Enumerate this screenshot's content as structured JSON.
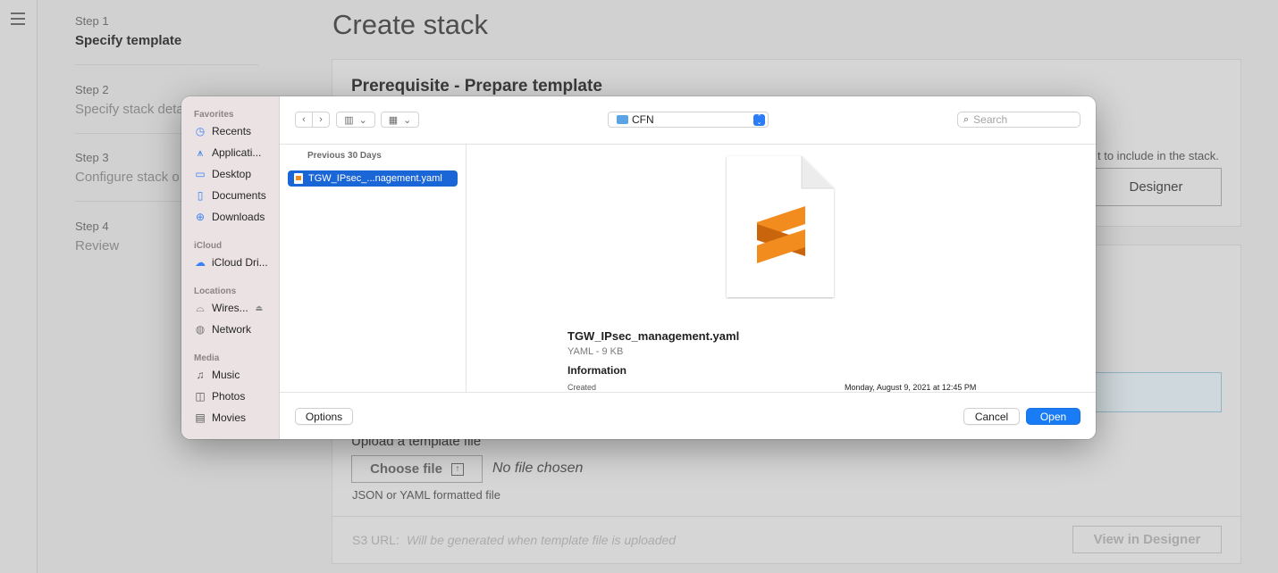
{
  "background": {
    "page_title": "Create stack",
    "steps": [
      {
        "num": "Step 1",
        "label": "Specify template"
      },
      {
        "num": "Step 2",
        "label": "Specify stack deta"
      },
      {
        "num": "Step 3",
        "label": "Configure stack o"
      },
      {
        "num": "Step 4",
        "label": "Review"
      }
    ],
    "prereq_title": "Prerequisite - Prepare template",
    "prereq_hint": "t to include in the stack.",
    "designer_button": "Designer",
    "upload_label": "Upload a template file",
    "choose_file": "Choose file",
    "no_file": "No file chosen",
    "format_hint": "JSON or YAML formatted file",
    "s3_label": "S3 URL:",
    "s3_placeholder": "Will be generated when template file is uploaded",
    "view_in_designer": "View in Designer"
  },
  "dialog": {
    "sidebar": {
      "favorites_label": "Favorites",
      "favorites": [
        {
          "label": "Recents",
          "icon": "clock-icon"
        },
        {
          "label": "Applicati...",
          "icon": "applications-icon"
        },
        {
          "label": "Desktop",
          "icon": "desktop-icon"
        },
        {
          "label": "Documents",
          "icon": "document-icon"
        },
        {
          "label": "Downloads",
          "icon": "download-icon"
        }
      ],
      "icloud_label": "iCloud",
      "icloud": [
        {
          "label": "iCloud Dri...",
          "icon": "cloud-icon"
        }
      ],
      "locations_label": "Locations",
      "locations": [
        {
          "label": "Wires...",
          "icon": "drive-icon"
        },
        {
          "label": "Network",
          "icon": "globe-icon"
        }
      ],
      "media_label": "Media",
      "media": [
        {
          "label": "Music",
          "icon": "music-icon"
        },
        {
          "label": "Photos",
          "icon": "camera-icon"
        },
        {
          "label": "Movies",
          "icon": "film-icon"
        }
      ]
    },
    "toolbar": {
      "folder": "CFN",
      "search_placeholder": "Search"
    },
    "list": {
      "group_header": "Previous 30 Days",
      "selected_file": "TGW_IPsec_...nagement.yaml"
    },
    "preview": {
      "file_name": "TGW_IPsec_management.yaml",
      "meta": "YAML - 9 KB",
      "info_heading": "Information",
      "created_label": "Created",
      "created_value": "Monday, August 9, 2021 at 12:45 PM"
    },
    "footer": {
      "options": "Options",
      "cancel": "Cancel",
      "open": "Open"
    },
    "colors": {
      "accent": "#1a7cf5",
      "sublime_orange": "#f28c1e"
    }
  }
}
